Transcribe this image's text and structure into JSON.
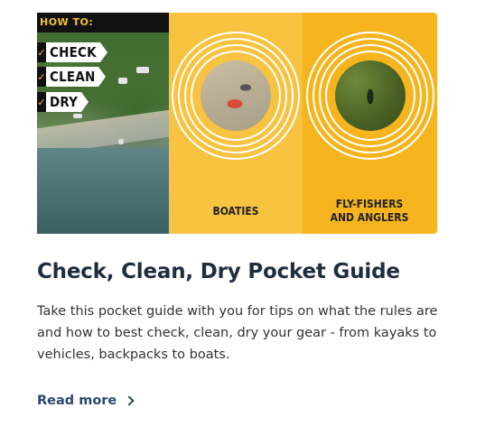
{
  "card": {
    "banner": {
      "howto": "HOW TO:",
      "steps": [
        "CHECK",
        "CLEAN",
        "DRY"
      ],
      "panels": [
        {
          "label": "BOATIES",
          "icon": "boat-trailer-photo"
        },
        {
          "label": "FLY-FISHERS AND ANGLERS",
          "icon": "angler-photo"
        }
      ],
      "colors": {
        "accent": "#f8c340",
        "accent_dark": "#f6b51f"
      }
    },
    "title": "Check, Clean, Dry Pocket Guide",
    "description": "Take this pocket guide with you for tips on what the rules are and how to best check, clean, dry your gear - from kayaks to vehicles, backpacks to boats.",
    "read_more": "Read more"
  }
}
